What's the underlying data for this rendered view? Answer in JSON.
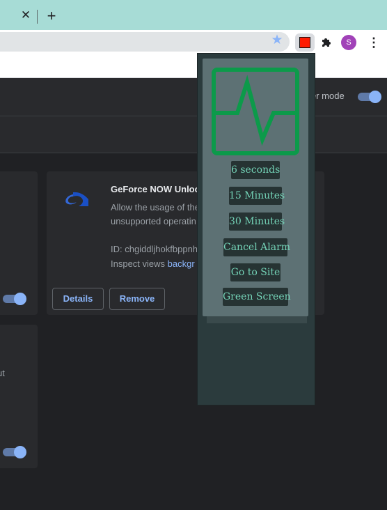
{
  "browser": {
    "tab_close_glyph": "✕",
    "new_tab_glyph": "+",
    "star_icon": "star-icon",
    "profile_initial": "S",
    "menu_glyph": "⋮",
    "colors": {
      "tabstrip": "#a7dcd6",
      "avatar": "#a142b8",
      "ext_icon_red": "#ff1a00"
    }
  },
  "extensions_page": {
    "dev_mode_label": "er mode",
    "dev_mode_on": true,
    "cards": [
      {
        "title": "GeForce NOW Unlock",
        "desc_line1": "Allow the usage of the",
        "desc_line2": "unsupported operatin",
        "id_line": "ID: chgiddljhokfbppnh",
        "inspect_prefix": "Inspect views ",
        "inspect_link": "backgr",
        "details_label": "Details",
        "remove_label": "Remove",
        "enabled": true
      }
    ],
    "left_fragment_1": ".",
    "left_fragment_2": "ut",
    "left_card_toggle_on": true
  },
  "popup": {
    "icon": "heartbeat-monitor-icon",
    "buttons": [
      {
        "label": "6 seconds"
      },
      {
        "label": "15 Minutes"
      },
      {
        "label": "30 Minutes"
      },
      {
        "label": "Cancel Alarm"
      },
      {
        "label": "Go to Site"
      },
      {
        "label": "Green Screen"
      }
    ],
    "colors": {
      "panel": "#5d7174",
      "button_bg": "#263333",
      "button_text": "#74d3b7",
      "pulse": "#0c9a4a"
    }
  }
}
